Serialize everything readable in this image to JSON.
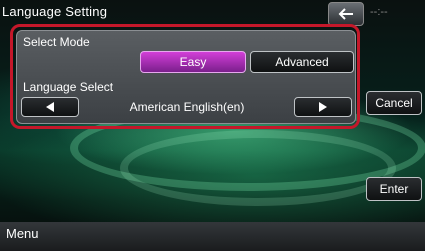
{
  "header": {
    "title": "Language Setting",
    "clock": "--:--"
  },
  "select_mode": {
    "label": "Select Mode",
    "options": {
      "easy": "Easy",
      "advanced": "Advanced"
    },
    "selected": "Easy"
  },
  "language_select": {
    "label": "Language Select",
    "value": "American English(en)"
  },
  "side": {
    "cancel": "Cancel",
    "enter": "Enter"
  },
  "footer": {
    "menu": "Menu"
  },
  "colors": {
    "accent": "#b02fbd",
    "highlight_frame": "#c4182a"
  },
  "icons": {
    "back": "back-arrow-icon",
    "prev": "left-arrow-icon",
    "next": "right-arrow-icon"
  }
}
